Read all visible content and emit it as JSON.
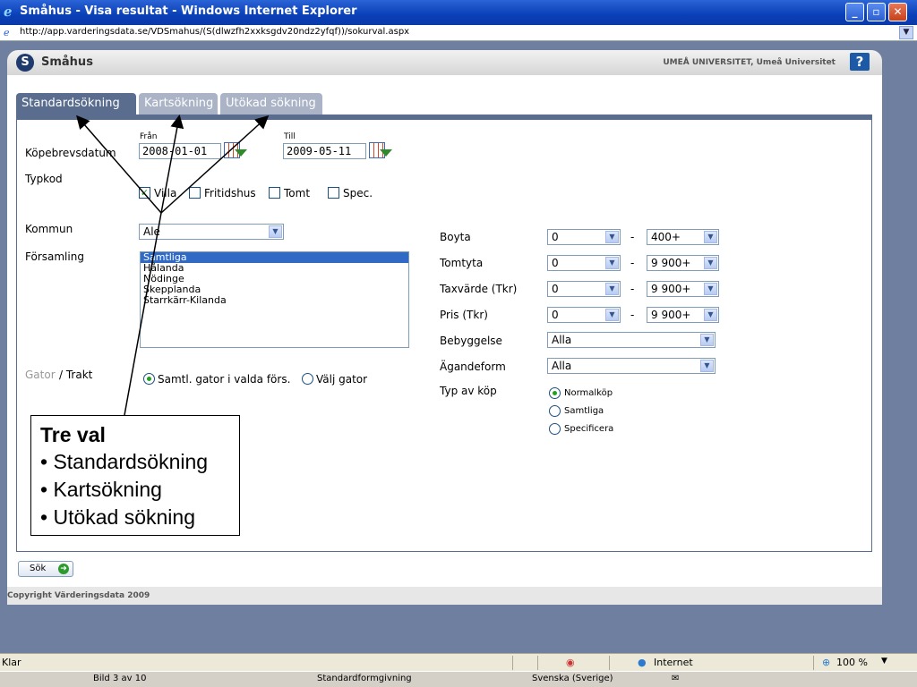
{
  "window": {
    "title": "Småhus - Visa resultat - Windows Internet Explorer",
    "minimize": "_",
    "maximize": "▫",
    "close": "✕"
  },
  "address": {
    "url": "http://app.varderingsdata.se/VDSmahus/(S(dlwzfh2xxksgdv20ndz2yfqf))/sokurval.aspx"
  },
  "header": {
    "logo_letter": "S",
    "app_name": "Småhus",
    "university": "UMEÅ UNIVERSITET, Umeå Universitet",
    "help": "?"
  },
  "tabs": [
    "Standardsökning",
    "Kartsökning",
    "Utökad sökning"
  ],
  "form": {
    "kopebrev_label": "Köpebrevsdatum",
    "from_label": "Från",
    "to_label": "Till",
    "from_value": "2008-01-01",
    "to_value": "2009-05-11",
    "typkod_label": "Typkod",
    "typkod_options": [
      {
        "label": "Villa",
        "checked": true
      },
      {
        "label": "Fritidshus",
        "checked": false
      },
      {
        "label": "Tomt",
        "checked": false
      },
      {
        "label": "Spec.",
        "checked": false
      }
    ],
    "kommun_label": "Kommun",
    "kommun_value": "Ale",
    "forsamling_label": "Församling",
    "forsamling_items": [
      "Samtliga",
      "Hålanda",
      "Nödinge",
      "Skepplanda",
      "Starrkärr-Kilanda"
    ],
    "gator_label": "Gator",
    "trakt_label": "/ Trakt",
    "gator_options": [
      "Samtl. gator i valda förs.",
      "Välj gator"
    ],
    "right": {
      "boyta_label": "Boyta",
      "boyta_from": "0",
      "boyta_to": "400+",
      "tomtyta_label": "Tomtyta",
      "tomtyta_from": "0",
      "tomtyta_to": "9 900+",
      "taxvarde_label": "Taxvärde (Tkr)",
      "taxvarde_from": "0",
      "taxvarde_to": "9 900+",
      "pris_label": "Pris (Tkr)",
      "pris_from": "0",
      "pris_to": "9 900+",
      "bebyggelse_label": "Bebyggelse",
      "bebyggelse_value": "Alla",
      "agandeform_label": "Ägandeform",
      "agandeform_value": "Alla",
      "typavkop_label": "Typ av köp",
      "typavkop_options": [
        "Normalköp",
        "Samtliga",
        "Specificera"
      ],
      "dash": "-"
    }
  },
  "callout": {
    "heading": "Tre val",
    "items": [
      "Standardsökning",
      "Kartsökning",
      "Utökad sökning"
    ],
    "bullet": "•"
  },
  "search_button": "Sök",
  "footer": "Copyright Värderingsdata 2009",
  "status": {
    "left": "Klar",
    "zone": "Internet",
    "zoom": "100 %"
  },
  "taskbar": {
    "slide": "Bild 3 av 10",
    "design": "Standardformgivning",
    "lang": "Svenska (Sverige)"
  }
}
